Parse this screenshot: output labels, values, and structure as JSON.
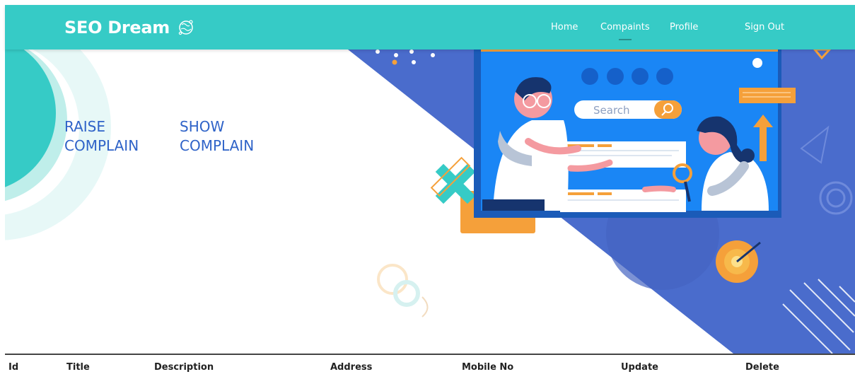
{
  "header": {
    "brand": "SEO Dream",
    "nav": [
      {
        "label": "Home",
        "active": false
      },
      {
        "label": "Compaints",
        "active": true
      },
      {
        "label": "Profile",
        "active": false
      },
      {
        "label": "Sign Out",
        "active": false
      }
    ]
  },
  "hero": {
    "links": [
      {
        "label": "RAISE\nCOMPLAIN"
      },
      {
        "label": "SHOW\nCOMPLAIN"
      }
    ],
    "illustration": {
      "search_placeholder": "Search"
    }
  },
  "table": {
    "columns": [
      "Id",
      "Title",
      "Description",
      "Address",
      "Mobile No",
      "Update",
      "Delete"
    ]
  },
  "colors": {
    "nav_bg": "#36cbc6",
    "link": "#2f63c8",
    "hero_blue": "#4a6ccc",
    "accent_orange": "#f5a03a"
  }
}
